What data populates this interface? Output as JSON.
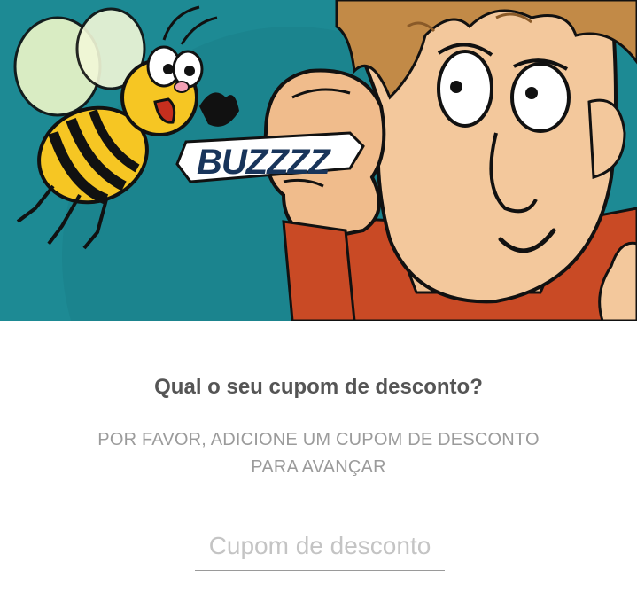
{
  "hero": {
    "image_name": "bee-buzzing-cartoon-illustration",
    "sound_text": "BUZZZZ",
    "colors": {
      "background": "#1d8a94",
      "bee_yellow": "#f6c623",
      "skin": "#f3c89c",
      "hair": "#c28a47",
      "shirt": "#c94a25"
    }
  },
  "main": {
    "title": "Qual o seu cupom de desconto?",
    "subtitle_line1": "POR FAVOR, ADICIONE UM CUPOM DE DESCONTO",
    "subtitle_line2": "PARA AVANÇAR",
    "coupon": {
      "value": "",
      "placeholder": "Cupom de desconto"
    }
  }
}
